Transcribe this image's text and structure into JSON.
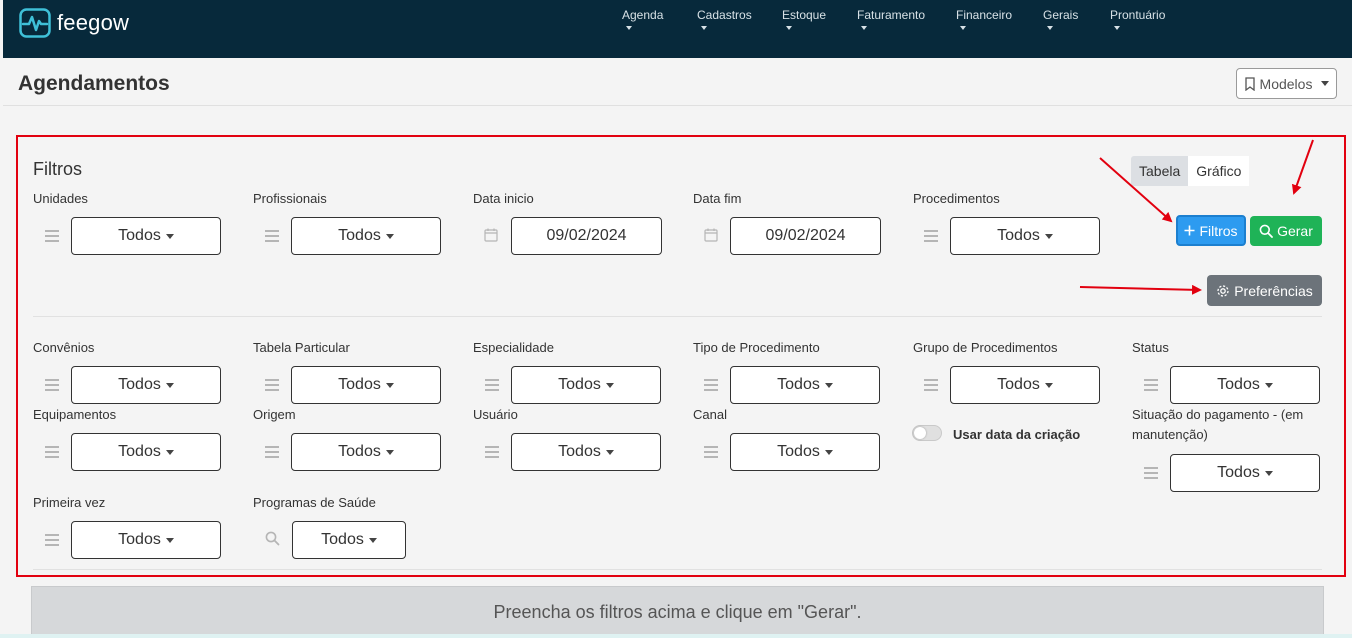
{
  "app": {
    "name": "feegow"
  },
  "nav": [
    {
      "label": "Agenda"
    },
    {
      "label": "Cadastros"
    },
    {
      "label": "Estoque"
    },
    {
      "label": "Faturamento"
    },
    {
      "label": "Financeiro"
    },
    {
      "label": "Gerais"
    },
    {
      "label": "Prontuário"
    }
  ],
  "header": {
    "title": "Agendamentos",
    "modelos_label": "Modelos"
  },
  "filters": {
    "title": "Filtros",
    "view_toggle": {
      "tabela": "Tabela",
      "grafico": "Gráfico"
    },
    "buttons": {
      "filtros": "Filtros",
      "gerar": "Gerar",
      "preferencias": "Preferências"
    },
    "fields": {
      "unidades": {
        "label": "Unidades",
        "value": "Todos"
      },
      "profissionais": {
        "label": "Profissionais",
        "value": "Todos"
      },
      "data_inicio": {
        "label": "Data inicio",
        "value": "09/02/2024"
      },
      "data_fim": {
        "label": "Data fim",
        "value": "09/02/2024"
      },
      "procedimentos": {
        "label": "Procedimentos",
        "value": "Todos"
      },
      "convenios": {
        "label": "Convênios",
        "value": "Todos"
      },
      "tabela_particular": {
        "label": "Tabela Particular",
        "value": "Todos"
      },
      "especialidade": {
        "label": "Especialidade",
        "value": "Todos"
      },
      "tipo_procedimento": {
        "label": "Tipo de Procedimento",
        "value": "Todos"
      },
      "grupo_procedimentos": {
        "label": "Grupo de Procedimentos",
        "value": "Todos"
      },
      "status": {
        "label": "Status",
        "value": "Todos"
      },
      "equipamentos": {
        "label": "Equipamentos",
        "value": "Todos"
      },
      "origem": {
        "label": "Origem",
        "value": "Todos"
      },
      "usuario": {
        "label": "Usuário",
        "value": "Todos"
      },
      "canal": {
        "label": "Canal",
        "value": "Todos"
      },
      "situacao_pagamento": {
        "label": "Situação do pagamento - (em manutenção)",
        "value": "Todos"
      },
      "primeira_vez": {
        "label": "Primeira vez",
        "value": "Todos"
      },
      "programas_saude": {
        "label": "Programas de Saúde",
        "value": "Todos"
      }
    },
    "usar_data_criacao": {
      "label": "Usar data da criação",
      "checked": false
    }
  },
  "message": "Preencha os filtros acima e clique em \"Gerar\".",
  "colors": {
    "topbar": "#07293b",
    "filtros_btn": "#2d9bf0",
    "gerar_btn": "#1fb357",
    "pref_btn": "#6c737a",
    "annotation": "#e2000f"
  }
}
